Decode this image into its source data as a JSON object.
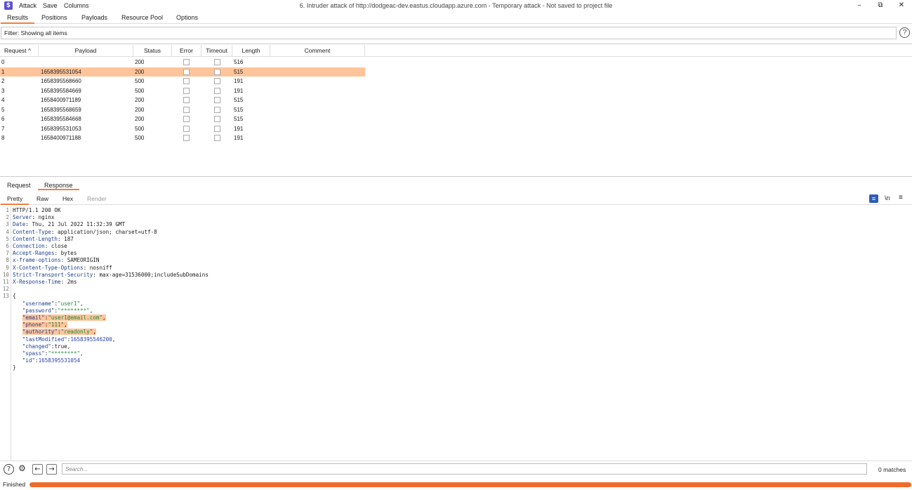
{
  "menu": {
    "attack": "Attack",
    "save": "Save",
    "columns": "Columns"
  },
  "window_title": "6. Intruder attack of http://dodgeac-dev.eastus.cloudapp.azure.com - Temporary attack - Not saved to project file",
  "window_controls": {
    "minimize": "–",
    "maximize": "⧉",
    "close": "✕"
  },
  "tabs": [
    "Results",
    "Positions",
    "Payloads",
    "Resource Pool",
    "Options"
  ],
  "filter_text": "Filter: Showing all items",
  "table": {
    "headers": {
      "request": "Request ^",
      "payload": "Payload",
      "status": "Status",
      "error": "Error",
      "timeout": "Timeout",
      "length": "Length",
      "comment": "Comment"
    },
    "rows": [
      {
        "request": "0",
        "payload": "",
        "status": "200",
        "length": "516"
      },
      {
        "request": "1",
        "payload": "1658395531054",
        "status": "200",
        "length": "515"
      },
      {
        "request": "2",
        "payload": "1658395568660",
        "status": "500",
        "length": "191"
      },
      {
        "request": "3",
        "payload": "1658395584669",
        "status": "500",
        "length": "191"
      },
      {
        "request": "4",
        "payload": "1658400971189",
        "status": "200",
        "length": "515"
      },
      {
        "request": "5",
        "payload": "1658395568659",
        "status": "200",
        "length": "515"
      },
      {
        "request": "6",
        "payload": "1658395584668",
        "status": "200",
        "length": "515"
      },
      {
        "request": "7",
        "payload": "1658395531053",
        "status": "500",
        "length": "191"
      },
      {
        "request": "8",
        "payload": "1658400971188",
        "status": "500",
        "length": "191"
      }
    ]
  },
  "detail_tabs": [
    "Request",
    "Response"
  ],
  "view_tabs": [
    "Pretty",
    "Raw",
    "Hex",
    "Render"
  ],
  "view_icons": {
    "newline": "\\n",
    "menu": "≡"
  },
  "response": {
    "line1": "HTTP/1.1 200 OK",
    "headers": [
      {
        "k": "Server",
        "v": " nginx"
      },
      {
        "k": "Date",
        "v": " Thu, 21 Jul 2022 11:32:39 GMT"
      },
      {
        "k": "Content-Type",
        "v": " application/json; charset=utf-8"
      },
      {
        "k": "Content-Length",
        "v": " 187"
      },
      {
        "k": "Connection",
        "v": " close"
      },
      {
        "k": "Accept-Ranges",
        "v": " bytes"
      },
      {
        "k": "x-frame-options",
        "v": " SAMEORIGIN"
      },
      {
        "k": "X-Content-Type-Options",
        "v": " nosniff"
      },
      {
        "k": "Strict-Transport-Security",
        "v": " max-age=31536000;includeSubDomains"
      },
      {
        "k": "X-Response-Time",
        "v": " 2ms"
      }
    ],
    "json_open": "{",
    "json_close": "}",
    "json_fields": [
      {
        "k": "\"username\"",
        "v": "\"user1\"",
        "t": "str",
        "hl": false
      },
      {
        "k": "\"password\"",
        "v": "\"********\"",
        "t": "str",
        "hl": false
      },
      {
        "k": "\"email\"",
        "v": "\"user1@email.com\"",
        "t": "str",
        "hl": true
      },
      {
        "k": "\"phone\"",
        "v": "\"111\"",
        "t": "str",
        "hl": true
      },
      {
        "k": "\"authority\"",
        "v": "\"readonly\"",
        "t": "str",
        "hl": true
      },
      {
        "k": "\"lastModified\"",
        "v": "1658395546200",
        "t": "num",
        "hl": false
      },
      {
        "k": "\"changed\"",
        "v": "true",
        "t": "plain",
        "hl": false
      },
      {
        "k": "\"spass\"",
        "v": "\"********\"",
        "t": "str",
        "hl": false
      },
      {
        "k": "\"id\"",
        "v": "1658395531054",
        "t": "num",
        "hl": false,
        "last": true
      }
    ]
  },
  "search": {
    "placeholder": "Search..."
  },
  "match_count": "0 matches",
  "status": "Finished",
  "progress": 1.0
}
